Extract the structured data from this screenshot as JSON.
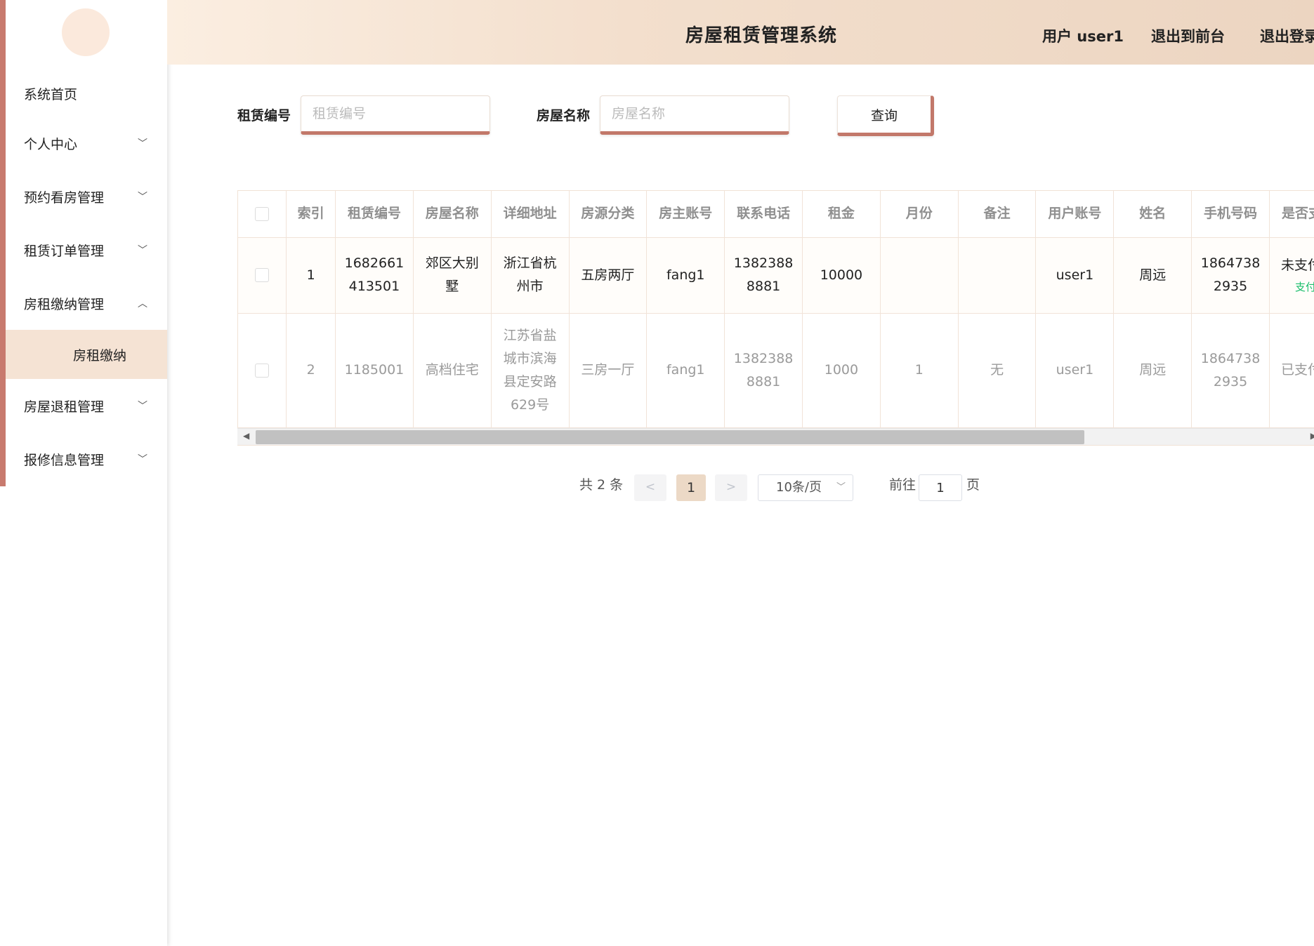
{
  "header": {
    "title": "房屋租赁管理系统",
    "user": "用户 user1",
    "front": "退出到前台",
    "logout": "退出登录"
  },
  "sidebar": {
    "items": [
      {
        "label": "系统首页"
      },
      {
        "label": "个人中心",
        "chevron": "chevron-down-icon"
      },
      {
        "label": "预约看房管理",
        "chevron": "chevron-down-icon"
      },
      {
        "label": "租赁订单管理",
        "chevron": "chevron-down-icon"
      },
      {
        "label": "房租缴纳管理",
        "chevron": "chevron-up-icon",
        "expanded": true
      },
      {
        "label": "房租缴纳",
        "sub": true,
        "active": true
      },
      {
        "label": "房屋退租管理",
        "chevron": "chevron-down-icon"
      },
      {
        "label": "报修信息管理",
        "chevron": "chevron-down-icon"
      }
    ]
  },
  "search": {
    "lease_no_label": "租赁编号",
    "lease_no_placeholder": "租赁编号",
    "house_name_label": "房屋名称",
    "house_name_placeholder": "房屋名称",
    "query_label": "查询"
  },
  "table": {
    "columns": [
      "索引",
      "租赁编号",
      "房屋名称",
      "详细地址",
      "房源分类",
      "房主账号",
      "联系电话",
      "租金",
      "月份",
      "备注",
      "用户账号",
      "姓名",
      "手机号码",
      "是否支付"
    ],
    "rows": [
      {
        "index": "1",
        "lease_no": "1682661\n413501",
        "house_name": "郊区大别\n墅",
        "address": "浙江省杭\n州市",
        "category": "五房两厅",
        "owner": "fang1",
        "phone": "1382388\n8881",
        "rent": "10000",
        "month": "",
        "note": "",
        "user": "user1",
        "name": "周远",
        "mobile": "1864738\n2935",
        "paid": "未支付",
        "action": "支付"
      },
      {
        "index": "2",
        "lease_no": "1185001",
        "house_name": "高档住宅",
        "address": "江苏省盐\n城市滨海\n县定安路\n629号",
        "category": "三房一厅",
        "owner": "fang1",
        "phone": "1382388\n8881",
        "rent": "1000",
        "month": "1",
        "note": "无",
        "user": "user1",
        "name": "周远",
        "mobile": "1864738\n2935",
        "paid": "已支付",
        "action": ""
      }
    ]
  },
  "pagination": {
    "total": "共 2 条",
    "prev": "<",
    "page": "1",
    "next": ">",
    "page_size": "10条/页",
    "goto_label": "前往",
    "goto_value": "1",
    "page_suffix": "页"
  },
  "colors": {
    "accent": "#c87a6e",
    "header_start": "#fbeee1",
    "header_end": "#ecd5c1",
    "active_menu": "#f5e3d4",
    "pay_link": "#19be6b"
  }
}
